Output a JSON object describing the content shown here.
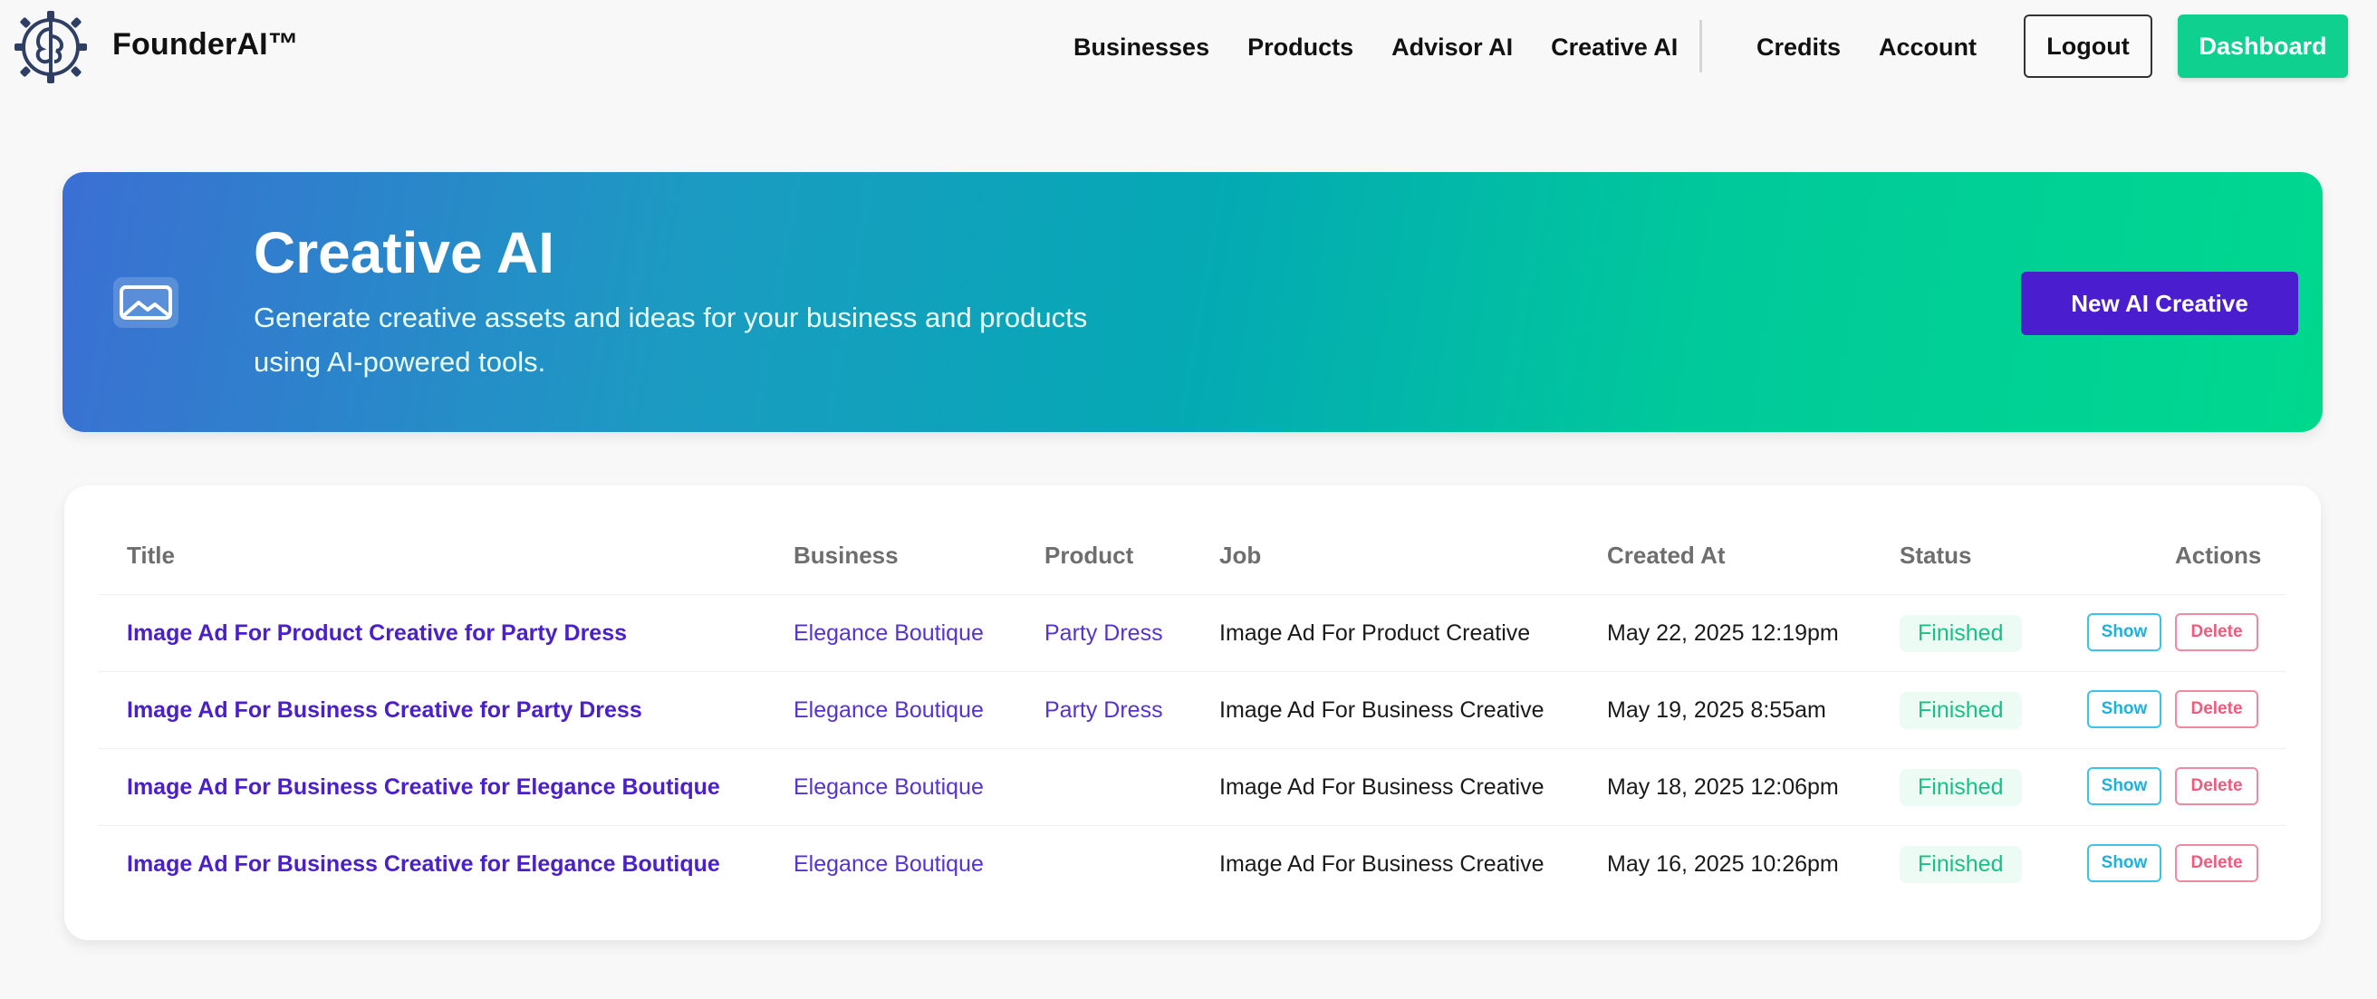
{
  "brand": {
    "name": "FounderAI™",
    "logo_icon": "brain-gear-icon"
  },
  "nav": {
    "links": [
      "Businesses",
      "Products",
      "Advisor AI",
      "Creative AI"
    ],
    "right_links": [
      "Credits",
      "Account"
    ],
    "logout_label": "Logout",
    "dashboard_label": "Dashboard"
  },
  "hero": {
    "icon": "image-icon",
    "title": "Creative AI",
    "description": "Generate creative assets and ideas for your business and products using AI-powered tools.",
    "button_label": "New AI Creative"
  },
  "table": {
    "headers": [
      "Title",
      "Business",
      "Product",
      "Job",
      "Created At",
      "Status",
      "Actions"
    ],
    "rows": [
      {
        "title": "Image Ad For Product Creative for Party Dress",
        "business": "Elegance Boutique",
        "product": "Party Dress",
        "job": "Image Ad For Product Creative",
        "created_at": "May 22, 2025 12:19pm",
        "status": "Finished",
        "show_label": "Show",
        "delete_label": "Delete"
      },
      {
        "title": "Image Ad For Business Creative for Party Dress",
        "business": "Elegance Boutique",
        "product": "Party Dress",
        "job": "Image Ad For Business Creative",
        "created_at": "May 19, 2025 8:55am",
        "status": "Finished",
        "show_label": "Show",
        "delete_label": "Delete"
      },
      {
        "title": "Image Ad For Business Creative for Elegance Boutique",
        "business": "Elegance Boutique",
        "product": "",
        "job": "Image Ad For Business Creative",
        "created_at": "May 18, 2025 12:06pm",
        "status": "Finished",
        "show_label": "Show",
        "delete_label": "Delete"
      },
      {
        "title": "Image Ad For Business Creative for Elegance Boutique",
        "business": "Elegance Boutique",
        "product": "",
        "job": "Image Ad For Business Creative",
        "created_at": "May 16, 2025 10:26pm",
        "status": "Finished",
        "show_label": "Show",
        "delete_label": "Delete"
      }
    ]
  },
  "colors": {
    "accent_green": "#10d08f",
    "accent_purple": "#4a1ecf",
    "show_blue": "#1fb1da",
    "delete_red": "#ef5a7d"
  }
}
